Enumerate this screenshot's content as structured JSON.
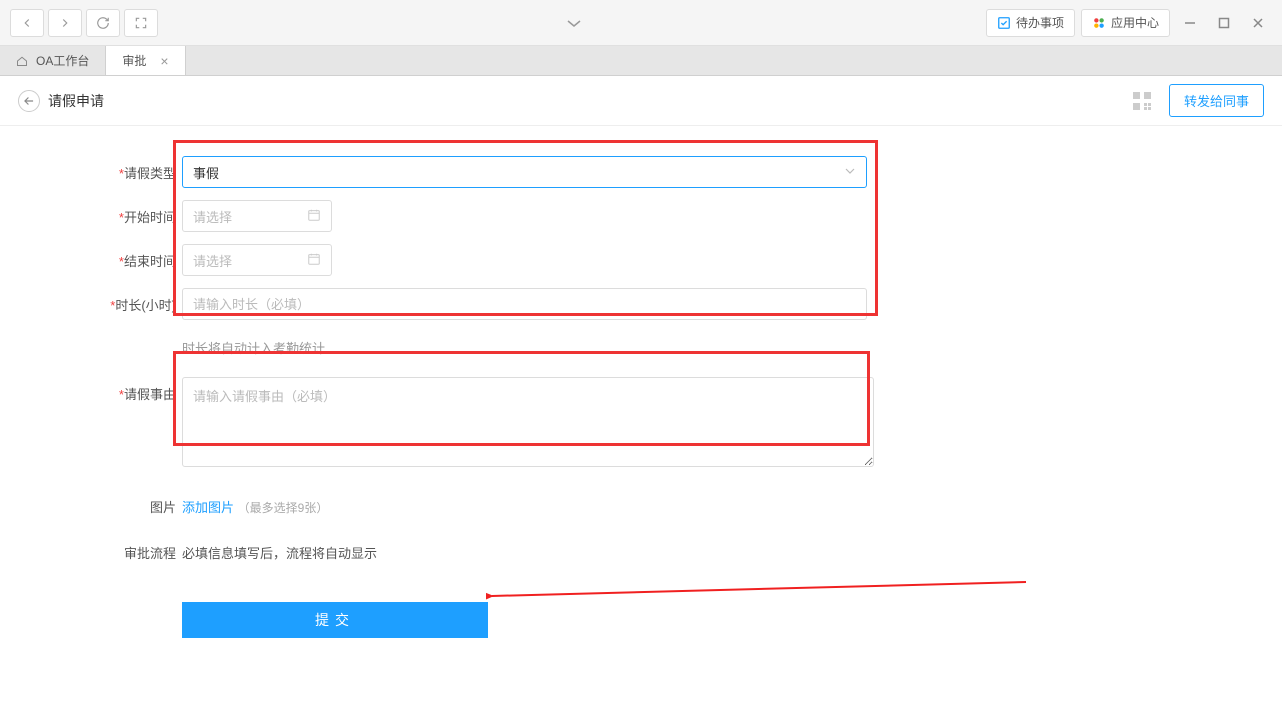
{
  "titlebar": {
    "todo_label": "待办事项",
    "appcenter_label": "应用中心"
  },
  "tabs": {
    "home": "OA工作台",
    "active": "审批"
  },
  "page": {
    "title": "请假申请",
    "forward_label": "转发给同事"
  },
  "form": {
    "leave_type": {
      "label": "请假类型",
      "value": "事假"
    },
    "start_time": {
      "label": "开始时间",
      "placeholder": "请选择"
    },
    "end_time": {
      "label": "结束时间",
      "placeholder": "请选择"
    },
    "duration": {
      "label": "时长(小时)",
      "placeholder": "请输入时长（必填）"
    },
    "duration_hint": "时长将自动计入考勤统计",
    "reason": {
      "label": "请假事由",
      "placeholder": "请输入请假事由（必填）"
    },
    "image": {
      "label": "图片",
      "link": "添加图片",
      "hint": "（最多选择9张）"
    },
    "flow": {
      "label": "审批流程",
      "text": "必填信息填写后，流程将自动显示"
    },
    "submit_label": "提交"
  }
}
